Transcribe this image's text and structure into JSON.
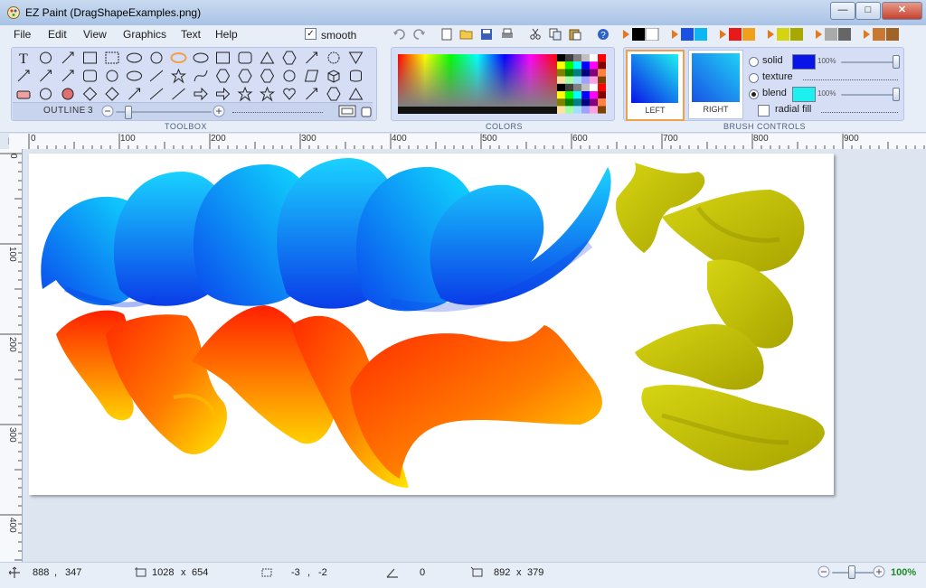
{
  "window": {
    "title": "EZ Paint (DragShapeExamples.png)",
    "minimize": "—",
    "maximize": "□",
    "close": "✕"
  },
  "menu": [
    "File",
    "Edit",
    "View",
    "Graphics",
    "Text",
    "Help"
  ],
  "smooth": {
    "label": "smooth",
    "checked": true,
    "mark": "✓"
  },
  "toolbar_icons": [
    "undo-icon",
    "redo-icon",
    "new-icon",
    "open-icon",
    "save-icon",
    "print-icon",
    "cut-icon",
    "copy-icon",
    "paste-icon",
    "help-icon"
  ],
  "toolbox": {
    "label": "TOOLBOX",
    "outline_label": "OUTLINE",
    "outline_value": "3",
    "outline_level": 0.1
  },
  "colors": {
    "label": "COLORS"
  },
  "brush": {
    "label": "BRUSH CONTROLS",
    "left_label": "LEFT",
    "right_label": "RIGHT",
    "solid_label": "solid",
    "solid_opacity": "100%",
    "texture_label": "texture",
    "blend_label": "blend",
    "blend_opacity": "100%",
    "radial_label": "radial fill",
    "selected_mode": "blend",
    "solid_color": "#0a14e6",
    "blend_color": "#1ef0f0"
  },
  "ruler": {
    "unit": "px",
    "h_labels": [
      "0",
      "100",
      "200",
      "300",
      "400",
      "500",
      "600",
      "700",
      "800",
      "900"
    ],
    "v_labels": [
      "0",
      "100",
      "200",
      "300",
      "400"
    ]
  },
  "status": {
    "cursor_x": "888",
    "cursor_sep": ",",
    "cursor_y": "347",
    "image_w": "1028",
    "image_x": "x",
    "image_h": "654",
    "offset_x": "-3",
    "offset_sep": ",",
    "offset_y": "-2",
    "angle": "0",
    "sel_w": "892",
    "sel_x": "x",
    "sel_h": "379",
    "zoom": "100%"
  },
  "colors_theme": {
    "accent": "#f0a04b",
    "blue_stroke": "#1060f0",
    "red_stroke": "#ff4000",
    "yellow_stroke": "#c8c800"
  }
}
